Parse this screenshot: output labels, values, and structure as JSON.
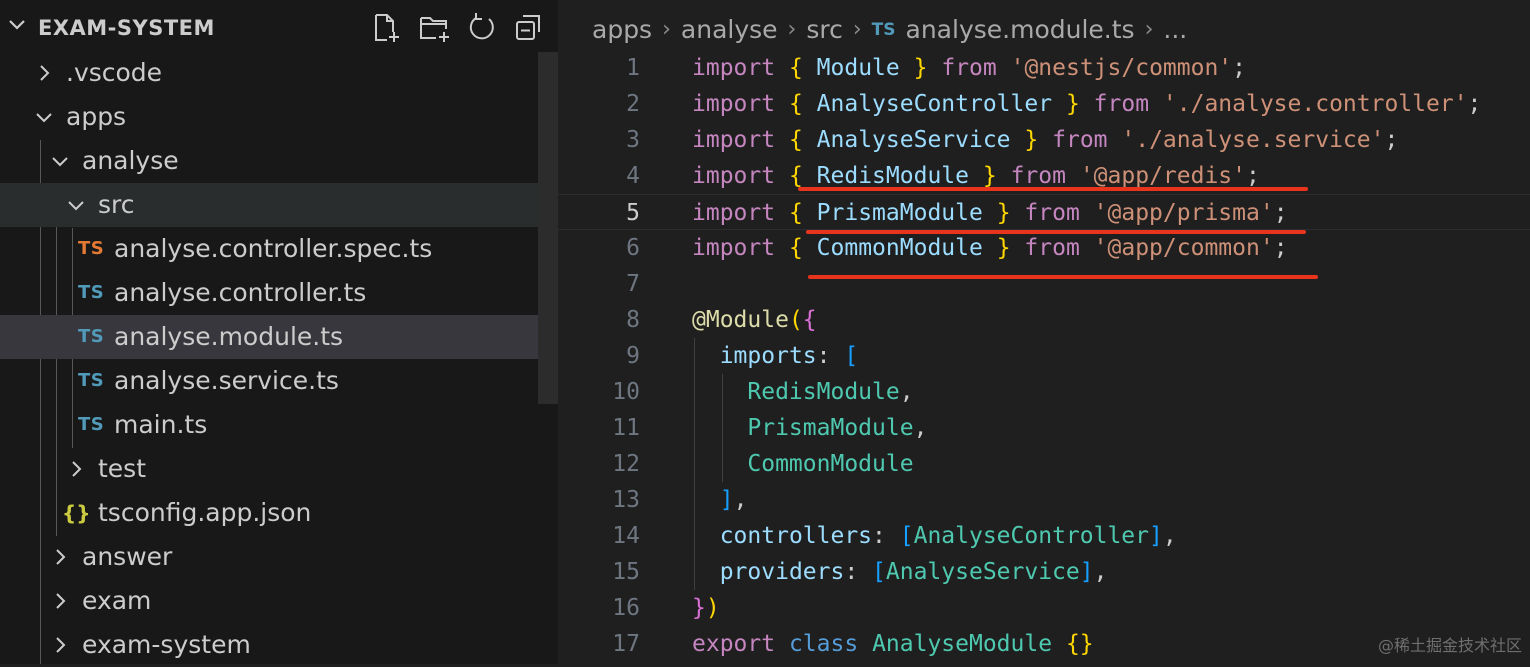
{
  "explorer": {
    "title": "EXAM-SYSTEM",
    "actions": [
      {
        "icon": "new-file-icon"
      },
      {
        "icon": "new-folder-icon"
      },
      {
        "icon": "refresh-icon"
      },
      {
        "icon": "collapse-all-icon"
      }
    ],
    "tree": [
      {
        "label": ".vscode",
        "type": "folder",
        "expanded": false
      },
      {
        "label": "apps",
        "type": "folder",
        "expanded": true
      },
      {
        "label": "analyse",
        "type": "folder",
        "expanded": true
      },
      {
        "label": "src",
        "type": "folder",
        "expanded": true
      },
      {
        "label": "analyse.controller.spec.ts",
        "type": "ts",
        "badge": "TS"
      },
      {
        "label": "analyse.controller.ts",
        "type": "ts",
        "badge": "TS"
      },
      {
        "label": "analyse.module.ts",
        "type": "ts",
        "badge": "TS",
        "selected": true
      },
      {
        "label": "analyse.service.ts",
        "type": "ts",
        "badge": "TS"
      },
      {
        "label": "main.ts",
        "type": "ts",
        "badge": "TS"
      },
      {
        "label": "test",
        "type": "folder",
        "expanded": false
      },
      {
        "label": "tsconfig.app.json",
        "type": "json",
        "badge": "{}"
      },
      {
        "label": "answer",
        "type": "folder",
        "expanded": false
      },
      {
        "label": "exam",
        "type": "folder",
        "expanded": false
      },
      {
        "label": "exam-system",
        "type": "folder",
        "expanded": false
      }
    ]
  },
  "breadcrumb": {
    "items": [
      "apps",
      "analyse",
      "src"
    ],
    "file_badge": "TS",
    "file": "analyse.module.ts",
    "more": "..."
  },
  "editor": {
    "current_line": 5,
    "lines": [
      {
        "n": "1",
        "t": [
          [
            "kw",
            "import"
          ],
          [
            "pn",
            " "
          ],
          [
            "br1",
            "{"
          ],
          [
            "pn",
            " "
          ],
          [
            "id",
            "Module"
          ],
          [
            "pn",
            " "
          ],
          [
            "br1",
            "}"
          ],
          [
            "pn",
            " "
          ],
          [
            "kw",
            "from"
          ],
          [
            "pn",
            " "
          ],
          [
            "str",
            "'@nestjs/common'"
          ],
          [
            "pn",
            ";"
          ]
        ]
      },
      {
        "n": "2",
        "t": [
          [
            "kw",
            "import"
          ],
          [
            "pn",
            " "
          ],
          [
            "br1",
            "{"
          ],
          [
            "pn",
            " "
          ],
          [
            "id",
            "AnalyseController"
          ],
          [
            "pn",
            " "
          ],
          [
            "br1",
            "}"
          ],
          [
            "pn",
            " "
          ],
          [
            "kw",
            "from"
          ],
          [
            "pn",
            " "
          ],
          [
            "str",
            "'./analyse.controller'"
          ],
          [
            "pn",
            ";"
          ]
        ]
      },
      {
        "n": "3",
        "t": [
          [
            "kw",
            "import"
          ],
          [
            "pn",
            " "
          ],
          [
            "br1",
            "{"
          ],
          [
            "pn",
            " "
          ],
          [
            "id",
            "AnalyseService"
          ],
          [
            "pn",
            " "
          ],
          [
            "br1",
            "}"
          ],
          [
            "pn",
            " "
          ],
          [
            "kw",
            "from"
          ],
          [
            "pn",
            " "
          ],
          [
            "str",
            "'./analyse.service'"
          ],
          [
            "pn",
            ";"
          ]
        ]
      },
      {
        "n": "4",
        "t": [
          [
            "kw",
            "import"
          ],
          [
            "pn",
            " "
          ],
          [
            "br1",
            "{"
          ],
          [
            "pn",
            " "
          ],
          [
            "id",
            "RedisModule"
          ],
          [
            "pn",
            " "
          ],
          [
            "br1",
            "}"
          ],
          [
            "pn",
            " "
          ],
          [
            "kw",
            "from"
          ],
          [
            "pn",
            " "
          ],
          [
            "str",
            "'@app/redis'"
          ],
          [
            "pn",
            ";"
          ]
        ]
      },
      {
        "n": "5",
        "t": [
          [
            "kw",
            "import"
          ],
          [
            "pn",
            " "
          ],
          [
            "br1",
            "{"
          ],
          [
            "pn",
            " "
          ],
          [
            "id",
            "PrismaModule"
          ],
          [
            "pn",
            " "
          ],
          [
            "br1",
            "}"
          ],
          [
            "pn",
            " "
          ],
          [
            "kw",
            "from"
          ],
          [
            "pn",
            " "
          ],
          [
            "str",
            "'@app/prisma'"
          ],
          [
            "pn",
            ";"
          ]
        ]
      },
      {
        "n": "6",
        "t": [
          [
            "kw",
            "import"
          ],
          [
            "pn",
            " "
          ],
          [
            "br1",
            "{"
          ],
          [
            "pn",
            " "
          ],
          [
            "id",
            "CommonModule"
          ],
          [
            "pn",
            " "
          ],
          [
            "br1",
            "}"
          ],
          [
            "pn",
            " "
          ],
          [
            "kw",
            "from"
          ],
          [
            "pn",
            " "
          ],
          [
            "str",
            "'@app/common'"
          ],
          [
            "pn",
            ";"
          ]
        ]
      },
      {
        "n": "7",
        "t": []
      },
      {
        "n": "8",
        "t": [
          [
            "dec",
            "@Module"
          ],
          [
            "br1",
            "("
          ],
          [
            "br2",
            "{"
          ]
        ]
      },
      {
        "n": "9",
        "t": [
          [
            "pn",
            "  "
          ],
          [
            "id",
            "imports"
          ],
          [
            "pn",
            ": "
          ],
          [
            "br3",
            "["
          ]
        ]
      },
      {
        "n": "10",
        "t": [
          [
            "pn",
            "    "
          ],
          [
            "ty",
            "RedisModule"
          ],
          [
            "pn",
            ","
          ]
        ]
      },
      {
        "n": "11",
        "t": [
          [
            "pn",
            "    "
          ],
          [
            "ty",
            "PrismaModule"
          ],
          [
            "pn",
            ","
          ]
        ]
      },
      {
        "n": "12",
        "t": [
          [
            "pn",
            "    "
          ],
          [
            "ty",
            "CommonModule"
          ]
        ]
      },
      {
        "n": "13",
        "t": [
          [
            "pn",
            "  "
          ],
          [
            "br3",
            "]"
          ],
          [
            "pn",
            ","
          ]
        ]
      },
      {
        "n": "14",
        "t": [
          [
            "pn",
            "  "
          ],
          [
            "id",
            "controllers"
          ],
          [
            "pn",
            ": "
          ],
          [
            "br3",
            "["
          ],
          [
            "ty",
            "AnalyseController"
          ],
          [
            "br3",
            "]"
          ],
          [
            "pn",
            ","
          ]
        ]
      },
      {
        "n": "15",
        "t": [
          [
            "pn",
            "  "
          ],
          [
            "id",
            "providers"
          ],
          [
            "pn",
            ": "
          ],
          [
            "br3",
            "["
          ],
          [
            "ty",
            "AnalyseService"
          ],
          [
            "br3",
            "]"
          ],
          [
            "pn",
            ","
          ]
        ]
      },
      {
        "n": "16",
        "t": [
          [
            "br2",
            "}"
          ],
          [
            "br1",
            ")"
          ]
        ]
      },
      {
        "n": "17",
        "t": [
          [
            "kw",
            "export"
          ],
          [
            "pn",
            " "
          ],
          [
            "kw-blue",
            "class"
          ],
          [
            "pn",
            " "
          ],
          [
            "ty",
            "AnalyseModule"
          ],
          [
            "pn",
            " "
          ],
          [
            "br1",
            "{}"
          ]
        ]
      }
    ]
  },
  "watermark": "@稀土掘金技术社区",
  "colors": {
    "annotation_underline": "#e8341c",
    "ts_badge": "#519aba",
    "spec_badge": "#e37933"
  }
}
